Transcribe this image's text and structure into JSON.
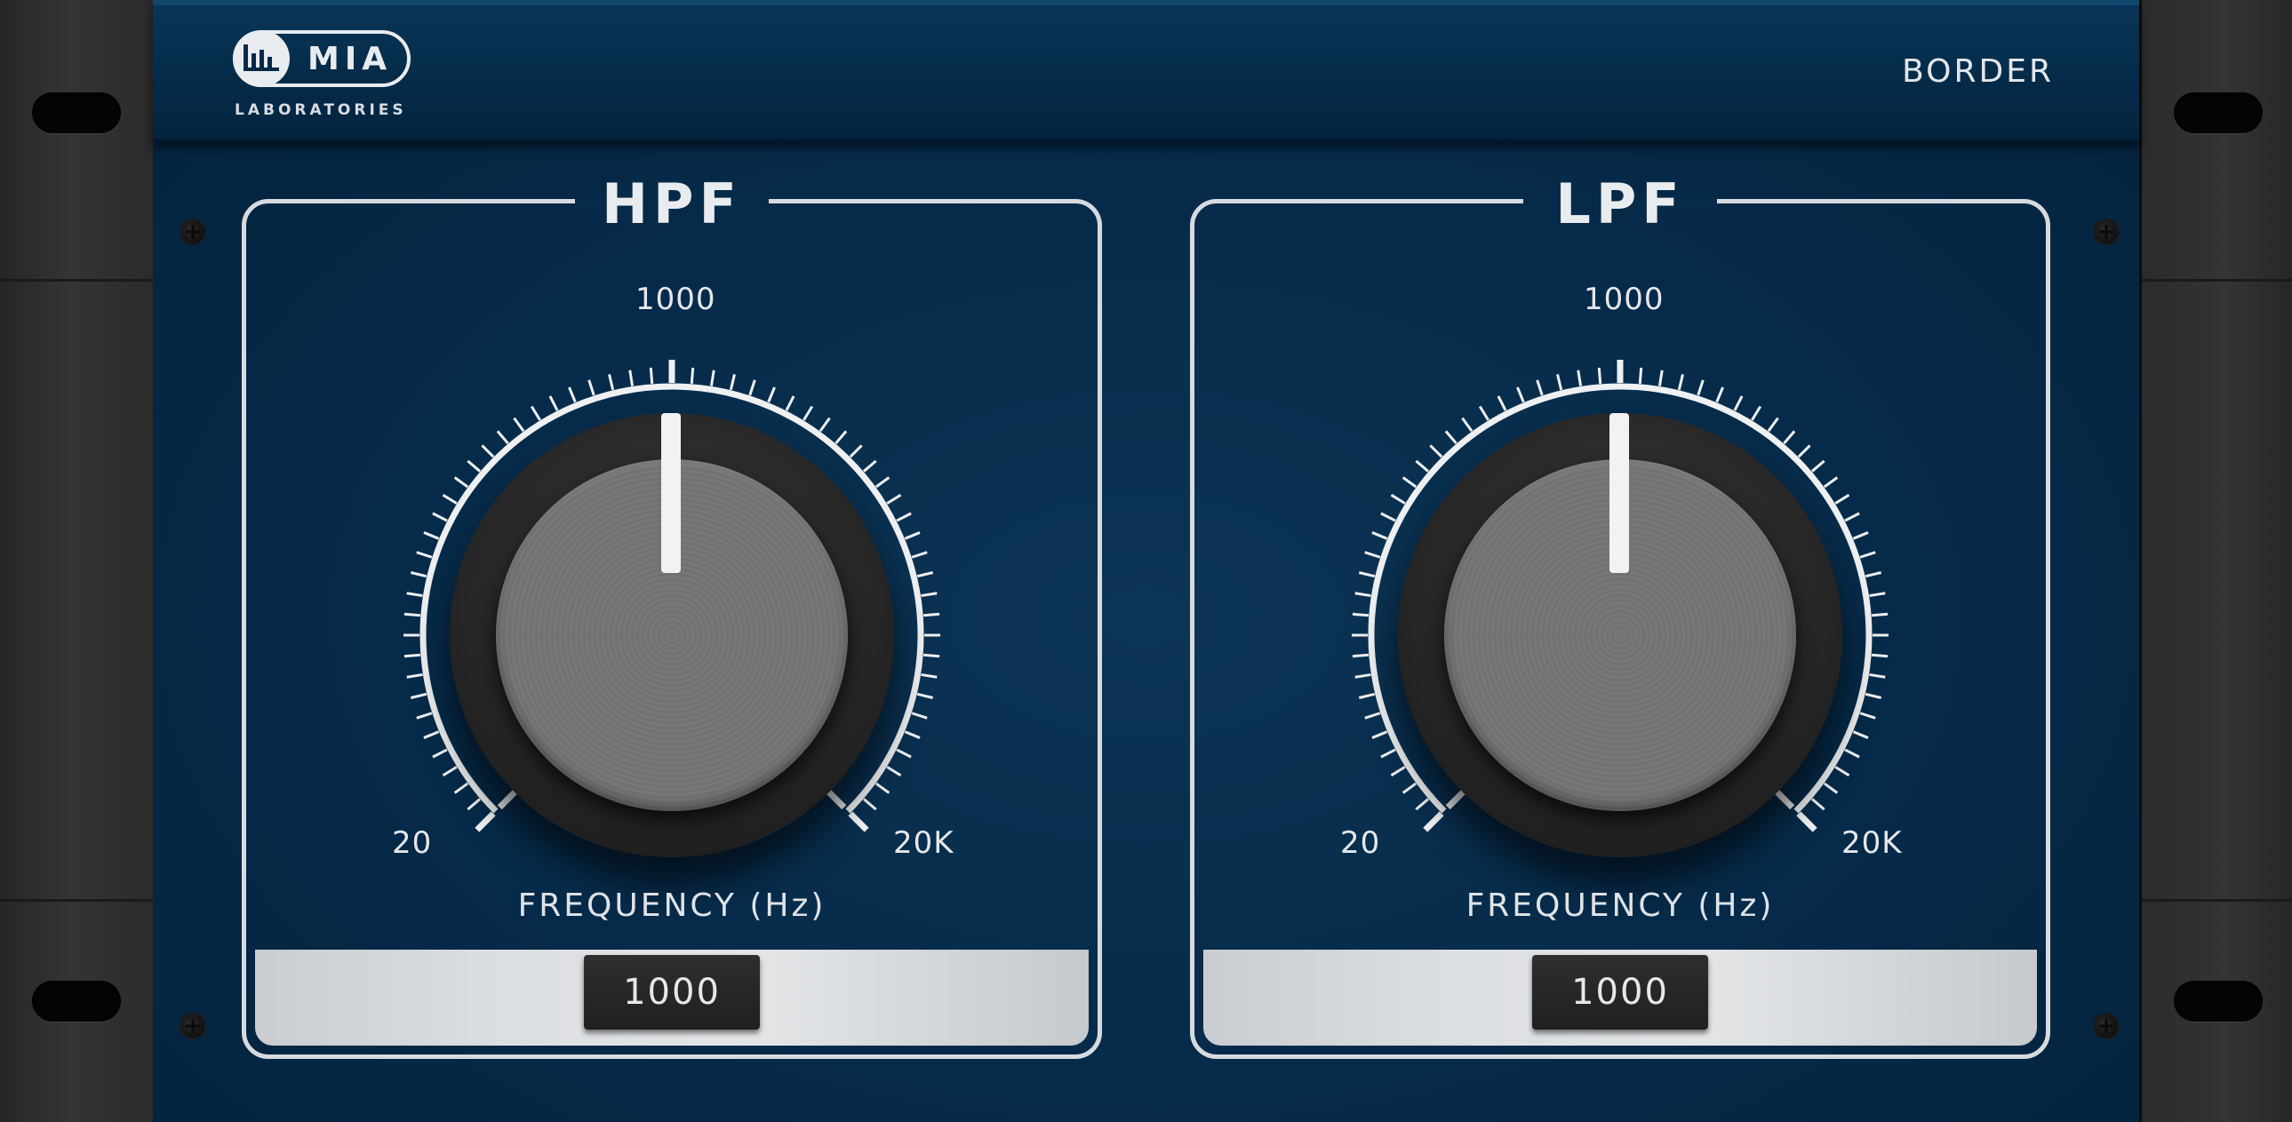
{
  "brand": {
    "logo_text": "MIA",
    "logo_sub": "LABORATORIES",
    "product_name": "BORDER"
  },
  "hpf": {
    "title": "HPF",
    "scale_top": "1000",
    "scale_min": "20",
    "scale_max": "20K",
    "param_label": "FREQUENCY (Hz)",
    "value": "1000"
  },
  "lpf": {
    "title": "LPF",
    "scale_top": "1000",
    "scale_min": "20",
    "scale_max": "20K",
    "param_label": "FREQUENCY (Hz)",
    "value": "1000"
  },
  "colors": {
    "panel": "#062a49",
    "accent": "#e9ecef"
  }
}
